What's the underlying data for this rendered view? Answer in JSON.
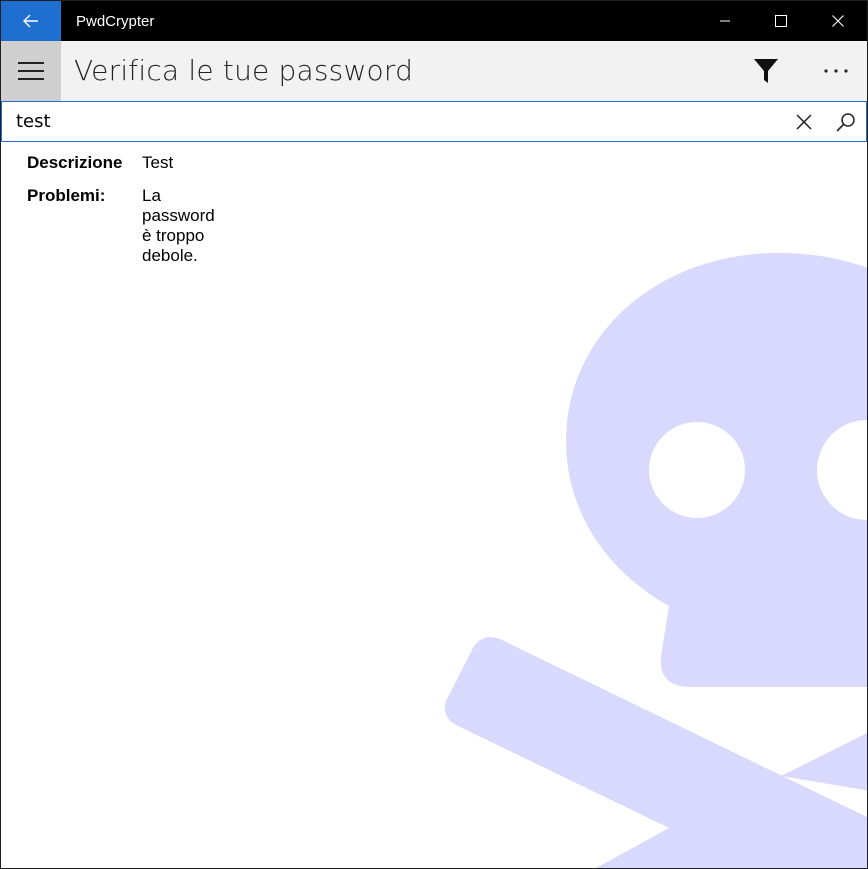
{
  "window": {
    "app_title": "PwdCrypter",
    "back_icon": "back-arrow-icon",
    "minimize_icon": "minimize-icon",
    "maximize_icon": "maximize-icon",
    "close_icon": "close-icon"
  },
  "header": {
    "menu_icon": "hamburger-menu-icon",
    "title": "Verifica le tue password",
    "filter_icon": "filter-icon",
    "more_icon": "more-ellipsis-icon"
  },
  "search": {
    "value": "test",
    "clear_icon": "clear-x-icon",
    "search_icon": "search-icon"
  },
  "result": {
    "description_label": "Descrizione",
    "description_value": "Test",
    "problems_label": "Problemi:",
    "problems_value": "La password è troppo debole."
  },
  "colors": {
    "accent": "#1e6fcf",
    "titlebar": "#000000",
    "header_bg": "#f2f2f2",
    "watermark": "#d9d9fe"
  },
  "background_icon": "skull-crossbones-icon"
}
